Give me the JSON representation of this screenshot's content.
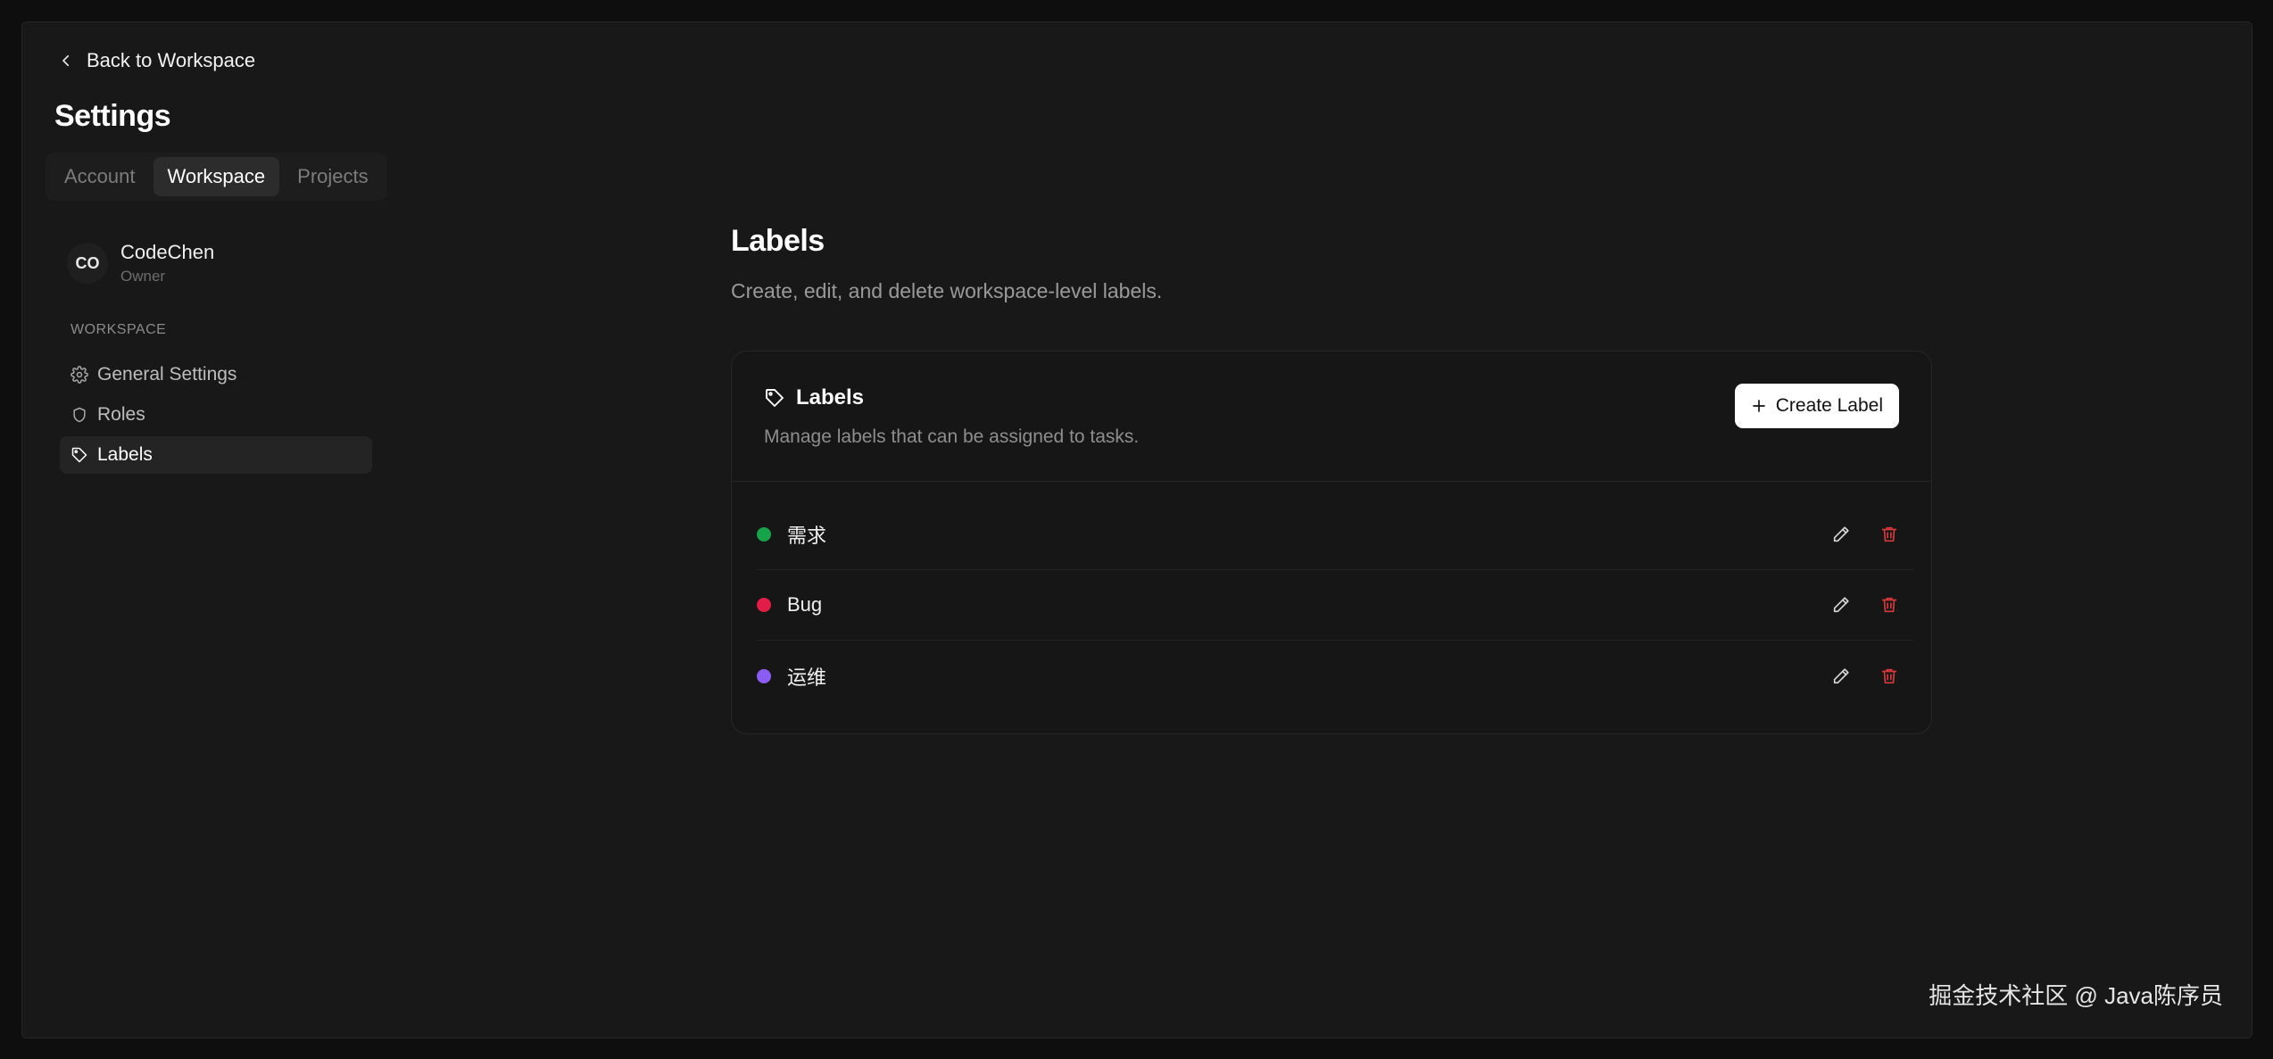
{
  "nav": {
    "back_label": "Back to Workspace",
    "settings_title": "Settings",
    "tabs": [
      {
        "label": "Account",
        "active": false
      },
      {
        "label": "Workspace",
        "active": true
      },
      {
        "label": "Projects",
        "active": false
      }
    ],
    "profile": {
      "initials": "CO",
      "name": "CodeChen",
      "role": "Owner"
    },
    "section_label": "WORKSPACE",
    "items": [
      {
        "label": "General Settings",
        "icon": "gear-icon",
        "active": false
      },
      {
        "label": "Roles",
        "icon": "shield-icon",
        "active": false
      },
      {
        "label": "Labels",
        "icon": "tag-icon",
        "active": true
      }
    ]
  },
  "main": {
    "title": "Labels",
    "subtitle": "Create, edit, and delete workspace-level labels.",
    "card": {
      "title": "Labels",
      "description": "Manage labels that can be assigned to tasks.",
      "create_label": "Create Label",
      "labels": [
        {
          "name": "需求",
          "color": "#16a34a"
        },
        {
          "name": "Bug",
          "color": "#e11d48"
        },
        {
          "name": "运维",
          "color": "#8b5cf6"
        }
      ]
    }
  },
  "watermark": "掘金技术社区 @ Java陈序员",
  "colors": {
    "background": "#181818",
    "accent_button": "#ffffff",
    "delete_icon": "#d9383a"
  }
}
